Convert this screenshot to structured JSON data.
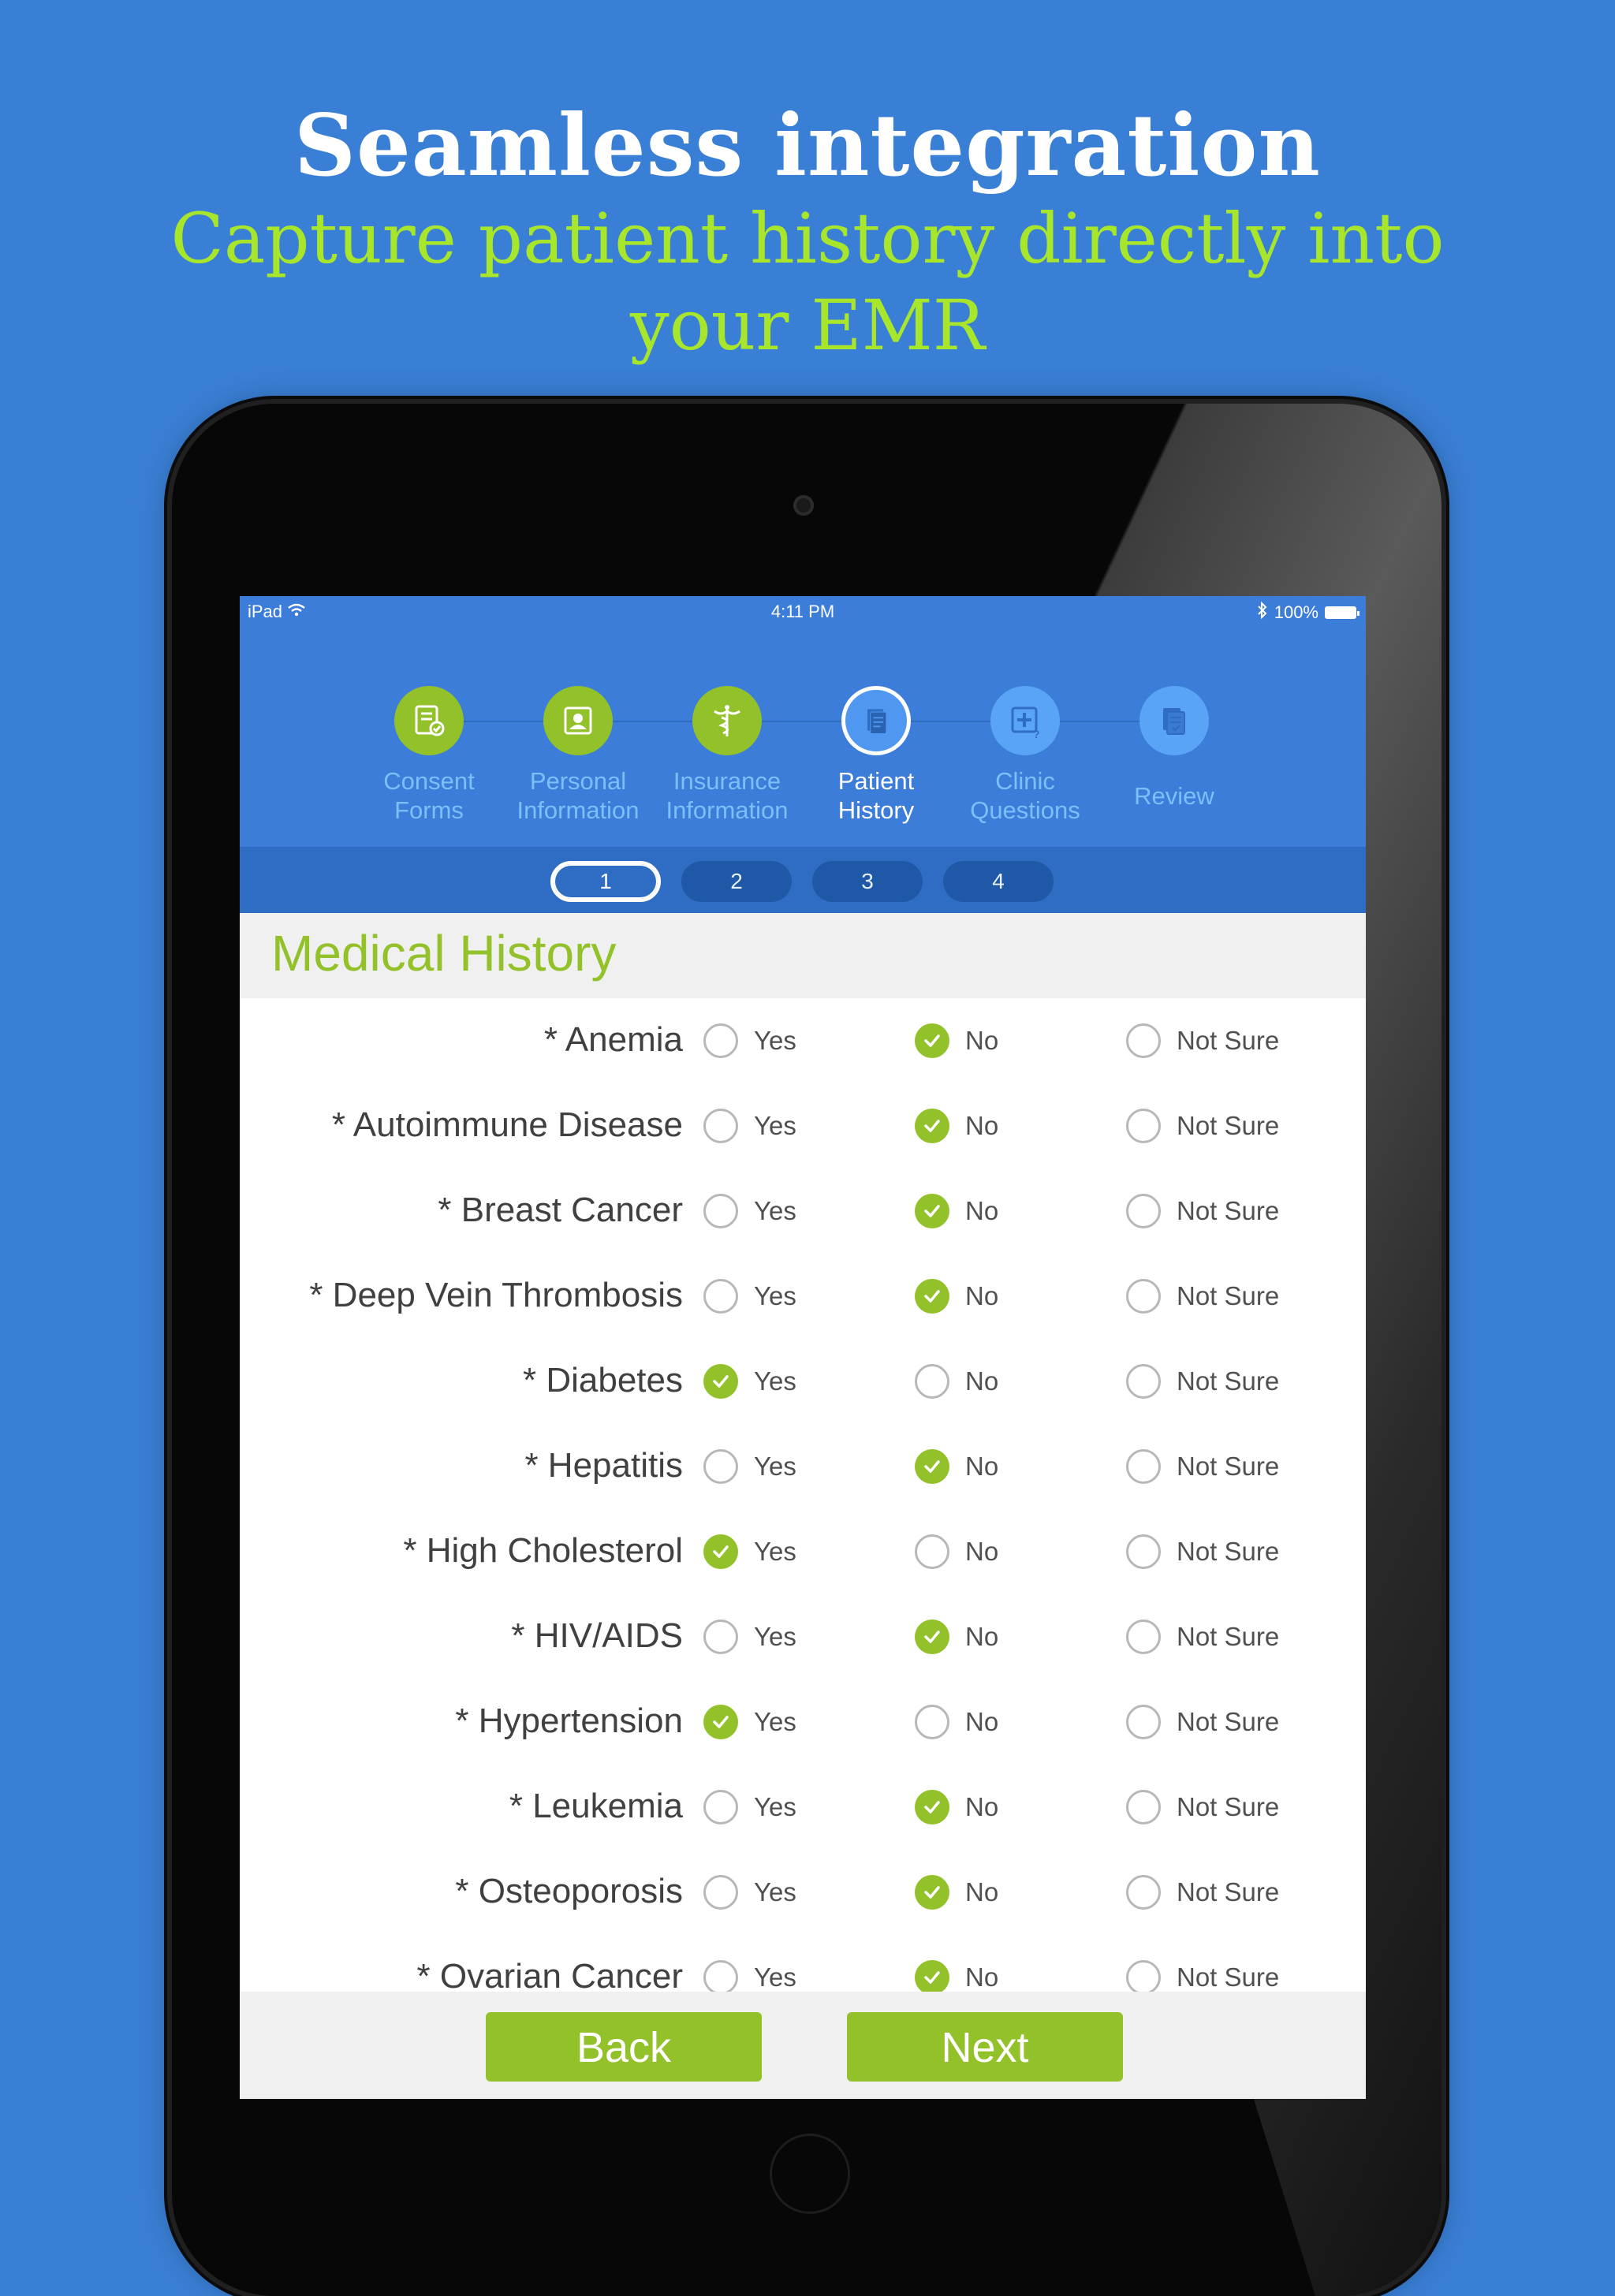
{
  "promo": {
    "headline": "Seamless integration",
    "subline": "Capture patient history directly into your EMR"
  },
  "status_bar": {
    "device": "iPad",
    "time": "4:11 PM",
    "battery": "100%"
  },
  "steps": [
    {
      "label_1": "Consent",
      "label_2": "Forms",
      "state": "done",
      "icon": "consent-form-icon"
    },
    {
      "label_1": "Personal",
      "label_2": "Information",
      "state": "done",
      "icon": "id-card-icon"
    },
    {
      "label_1": "Insurance",
      "label_2": "Information",
      "state": "done",
      "icon": "caduceus-icon"
    },
    {
      "label_1": "Patient",
      "label_2": "History",
      "state": "active",
      "icon": "document-icon"
    },
    {
      "label_1": "Clinic",
      "label_2": "Questions",
      "state": "todo",
      "icon": "medical-question-icon"
    },
    {
      "label_1": "Review",
      "state": "todo",
      "icon": "checklist-icon"
    }
  ],
  "pager": {
    "pages": [
      "1",
      "2",
      "3",
      "4"
    ],
    "active": "1"
  },
  "section": {
    "title": "Medical History"
  },
  "options": {
    "yes": "Yes",
    "no": "No",
    "not_sure": "Not Sure"
  },
  "conditions": [
    {
      "label": "* Anemia",
      "answer": "No"
    },
    {
      "label": "* Autoimmune Disease",
      "answer": "No"
    },
    {
      "label": "* Breast Cancer",
      "answer": "No"
    },
    {
      "label": "* Deep Vein Thrombosis",
      "answer": "No"
    },
    {
      "label": "* Diabetes",
      "answer": "Yes"
    },
    {
      "label": "* Hepatitis",
      "answer": "No"
    },
    {
      "label": "* High Cholesterol",
      "answer": "Yes"
    },
    {
      "label": "* HIV/AIDS",
      "answer": "No"
    },
    {
      "label": "* Hypertension",
      "answer": "Yes"
    },
    {
      "label": "* Leukemia",
      "answer": "No"
    },
    {
      "label": "* Osteoporosis",
      "answer": "No"
    },
    {
      "label": "* Ovarian Cancer",
      "answer": "No"
    }
  ],
  "footer": {
    "back": "Back",
    "next": "Next"
  },
  "colors": {
    "background": "#3a7fd6",
    "accent_green": "#93c12a",
    "subline_green": "#a8e62b",
    "header_blue": "#3b7dd8"
  }
}
